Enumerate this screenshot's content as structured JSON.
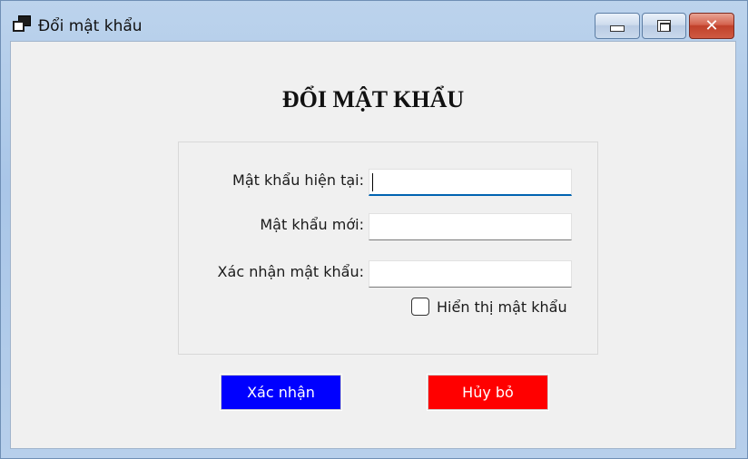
{
  "window": {
    "title": "Đổi mật khẩu",
    "icon": "app-window-icon",
    "controls": {
      "minimize": "minimize-icon",
      "maximize": "maximize-icon",
      "close": "close-icon",
      "close_glyph": "✕"
    }
  },
  "form": {
    "heading": "ĐỔI MẬT KHẨU",
    "fields": {
      "current_password": {
        "label": "Mật khẩu hiện tại:",
        "value": ""
      },
      "new_password": {
        "label": "Mật khẩu mới:",
        "value": ""
      },
      "confirm_password": {
        "label": "Xác nhận mật khẩu:",
        "value": ""
      }
    },
    "show_password": {
      "label": "Hiển thị mật khẩu",
      "checked": false
    }
  },
  "buttons": {
    "confirm": {
      "label": "Xác nhận",
      "color": "#0000ff"
    },
    "cancel": {
      "label": "Hủy bỏ",
      "color": "#ff0000"
    }
  },
  "colors": {
    "focus_underline": "#0063b1",
    "client_bg": "#f0f0f0"
  }
}
